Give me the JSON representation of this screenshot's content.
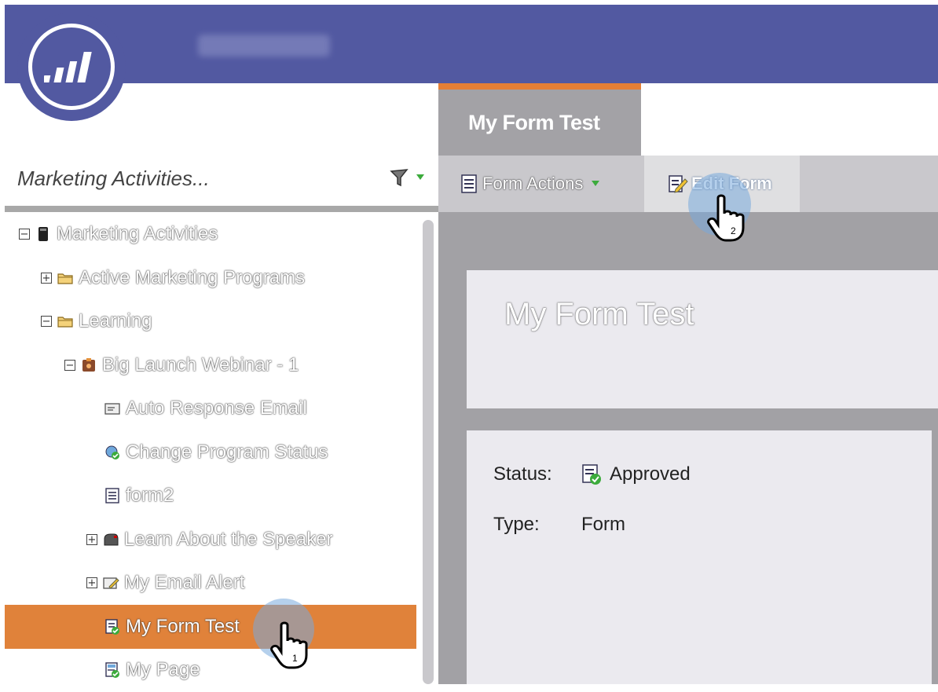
{
  "header": {
    "app_name_blurred": ""
  },
  "tab": {
    "label": "My Form Test"
  },
  "sidebar": {
    "title": "Marketing Activities...",
    "tree": [
      {
        "label": "Marketing Activities",
        "toggle": "−",
        "icon": "database-icon",
        "indent": 0
      },
      {
        "label": "Active Marketing Programs",
        "toggle": "+",
        "icon": "folder-icon",
        "indent": 1
      },
      {
        "label": "Learning",
        "toggle": "−",
        "icon": "folder-icon",
        "indent": 1
      },
      {
        "label": "Big Launch Webinar - 1",
        "toggle": "−",
        "icon": "webinar-program-icon",
        "indent": 2
      },
      {
        "label": "Auto Response Email",
        "toggle": "",
        "icon": "email-icon",
        "indent": 3
      },
      {
        "label": "Change Program Status",
        "toggle": "",
        "icon": "status-icon",
        "indent": 3
      },
      {
        "label": "form2",
        "toggle": "",
        "icon": "form-icon",
        "indent": 3
      },
      {
        "label": "Learn About the Speaker",
        "toggle": "+",
        "icon": "mailbox-icon",
        "indent": 3
      },
      {
        "label": "My Email Alert",
        "toggle": "+",
        "icon": "email-alert-icon",
        "indent": 3
      },
      {
        "label": "My Form Test",
        "toggle": "",
        "icon": "approved-form-icon",
        "indent": 3,
        "selected": true
      },
      {
        "label": "My Page",
        "toggle": "",
        "icon": "landing-page-icon",
        "indent": 3
      }
    ]
  },
  "toolbar": {
    "form_actions": "Form Actions",
    "edit_form": "Edit Form"
  },
  "main": {
    "title": "My Form Test",
    "status_label": "Status:",
    "status_value": "Approved",
    "type_label": "Type:",
    "type_value": "Form"
  },
  "cursors": [
    {
      "step": "1"
    },
    {
      "step": "2"
    }
  ],
  "colors": {
    "brand": "#5259a1",
    "accent": "#e57f36",
    "selected_row": "#e0823a"
  }
}
